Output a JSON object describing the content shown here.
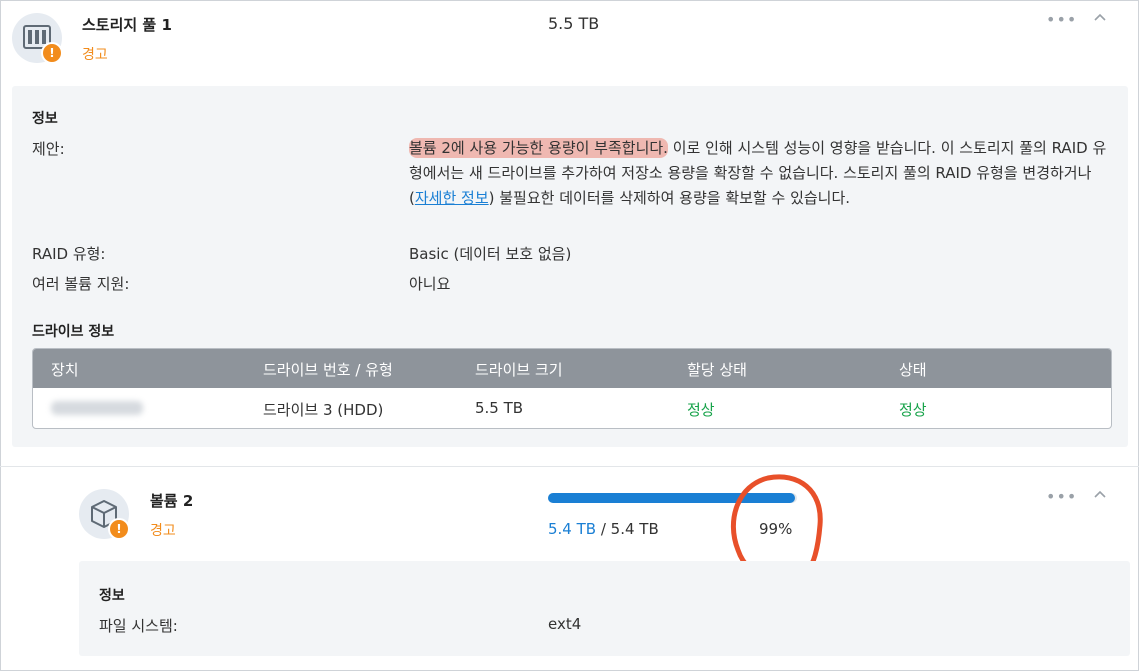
{
  "pool": {
    "title": "스토리지 풀 1",
    "status": "경고",
    "size": "5.5 TB",
    "more_icon": "ellipsis-icon",
    "collapse_icon": "chevron-up-icon",
    "info": {
      "section_title": "정보",
      "suggestion_label": "제안:",
      "suggestion_highlight": "볼륨 2에 사용 가능한 용량이 부족합니다.",
      "suggestion_text_1": " 이로 인해 시스템 성능이 영향을 받습니다. 이 스토리지 풀의 RAID 유형에서는 새 드라이브를 추가하여 저장소 용량을 확장할 수 없습니다. 스토리지 풀의 RAID 유형을 변경하거나(",
      "suggestion_link": "자세한 정보",
      "suggestion_text_2": ") 불필요한 데이터를 삭제하여 용량을 확보할 수 있습니다.",
      "raid_label": "RAID 유형:",
      "raid_value": "Basic (데이터 보호 없음)",
      "multi_volume_label": "여러 볼륨 지원:",
      "multi_volume_value": "아니요"
    },
    "drives": {
      "section_title": "드라이브 정보",
      "columns": [
        "장치",
        "드라이브 번호 / 유형",
        "드라이브 크기",
        "할당 상태",
        "상태"
      ],
      "rows": [
        {
          "device": "",
          "slot": "드라이브 3 (HDD)",
          "size": "5.5 TB",
          "allocation": "정상",
          "status": "정상"
        }
      ]
    }
  },
  "volume": {
    "title": "볼륨 2",
    "status": "경고",
    "used": "5.4 TB",
    "separator": " / ",
    "total": "5.4 TB",
    "percent": "99%",
    "usage_fraction": 0.99,
    "info": {
      "section_title": "정보",
      "fs_label": "파일 시스템:",
      "fs_value": "ext4"
    }
  },
  "colors": {
    "accent": "#1a7fd4",
    "warning": "#f28c1c",
    "ok": "#17a34a",
    "annotation": "#e8502a"
  }
}
